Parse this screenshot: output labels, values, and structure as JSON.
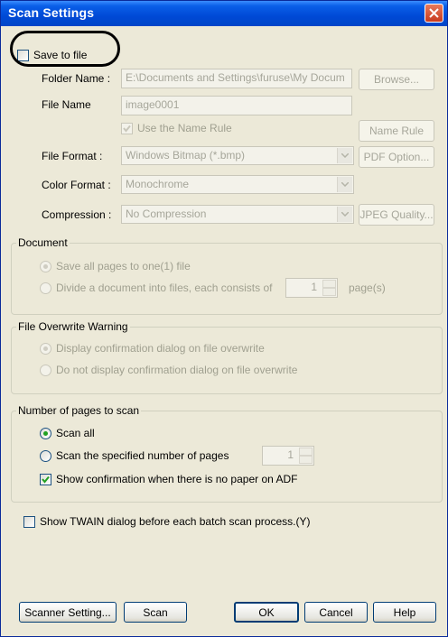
{
  "window": {
    "title": "Scan Settings"
  },
  "save_to_file": {
    "label": "Save to file",
    "checked": false
  },
  "file_fields": {
    "folder_name": {
      "label": "Folder Name :",
      "value": "E:\\Documents and Settings\\furuse\\My Docum",
      "browse_label": "Browse..."
    },
    "file_name": {
      "label": "File Name",
      "value": "image0001"
    },
    "use_name_rule": {
      "label": "Use the Name Rule",
      "checked": true
    },
    "name_rule_button": "Name Rule",
    "file_format": {
      "label": "File Format :",
      "value": "Windows Bitmap (*.bmp)",
      "button": "PDF Option..."
    },
    "color_format": {
      "label": "Color Format :",
      "value": "Monochrome"
    },
    "compression": {
      "label": "Compression :",
      "value": "No Compression",
      "button": "JPEG Quality..."
    }
  },
  "document_group": {
    "title": "Document",
    "option1": "Save all pages to one(1) file",
    "option2": "Divide a document into files, each consists of",
    "pages_value": "1",
    "pages_unit": "page(s)"
  },
  "overwrite_group": {
    "title": "File Overwrite Warning",
    "option1": "Display confirmation dialog on file overwrite",
    "option2": "Do not display confirmation dialog on file overwrite"
  },
  "pages_group": {
    "title": "Number of pages to scan",
    "option1": "Scan all",
    "option2": "Scan the specified number of pages",
    "pages_value": "1",
    "confirm_label": "Show confirmation when there is no paper on ADF"
  },
  "twain_checkbox": {
    "label": "Show TWAIN dialog before each batch scan process.(Y)",
    "checked": false
  },
  "buttons": {
    "scanner_setting": "Scanner Setting...",
    "scan": "Scan",
    "ok": "OK",
    "cancel": "Cancel",
    "help": "Help"
  },
  "colors": {
    "titlebar": "#0049d6",
    "dialog_bg": "#ece9d8",
    "close_red": "#c83a1e",
    "check_green": "#21a121"
  }
}
